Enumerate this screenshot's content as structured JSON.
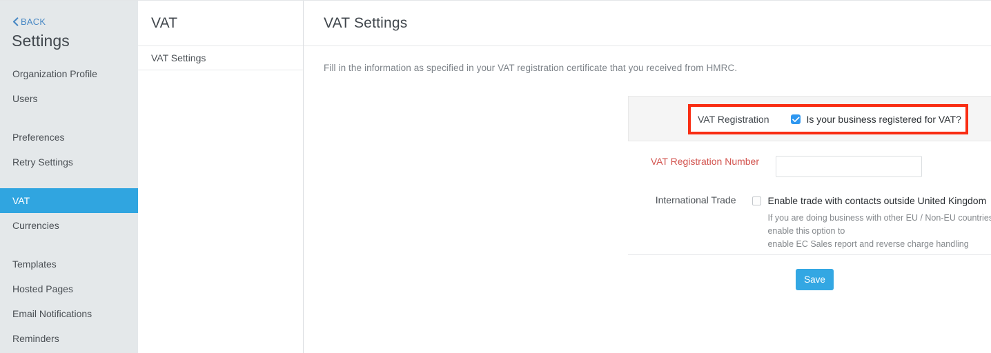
{
  "sidebar": {
    "back_label": "BACK",
    "back_icon": "chevron-left-icon",
    "title": "Settings",
    "groups": [
      {
        "items": [
          {
            "label": "Organization Profile",
            "active": false
          },
          {
            "label": "Users",
            "active": false
          }
        ]
      },
      {
        "items": [
          {
            "label": "Preferences",
            "active": false
          },
          {
            "label": "Retry Settings",
            "active": false
          }
        ]
      },
      {
        "items": [
          {
            "label": "VAT",
            "active": true
          },
          {
            "label": "Currencies",
            "active": false
          }
        ]
      },
      {
        "items": [
          {
            "label": "Templates",
            "active": false
          },
          {
            "label": "Hosted Pages",
            "active": false
          },
          {
            "label": "Email Notifications",
            "active": false
          },
          {
            "label": "Reminders",
            "active": false
          }
        ]
      }
    ]
  },
  "midcol": {
    "title": "VAT",
    "items": [
      {
        "label": "VAT Settings"
      }
    ]
  },
  "main": {
    "title": "VAT Settings",
    "description": "Fill in the information as specified in your VAT registration certificate that you received from HMRC.",
    "vat_registration": {
      "label": "VAT Registration",
      "checkbox_icon": "checkmark-icon",
      "checkbox_checked": true,
      "question": "Is your business registered for VAT?"
    },
    "vat_registration_number": {
      "label": "VAT Registration Number",
      "value": "",
      "placeholder": ""
    },
    "international_trade": {
      "label": "International Trade",
      "checkbox_checked": false,
      "option_label": "Enable trade with contacts outside United Kingdom",
      "help_line_1": "If you are doing business with other EU / Non-EU countries, enable this option to",
      "help_line_2": "enable EC Sales report and reverse charge handling"
    },
    "save_label": "Save"
  },
  "colors": {
    "accent_blue": "#33a7e3",
    "sidebar_bg": "#e4e8ea",
    "required_red": "#d2524d",
    "highlight_red": "#f92d13",
    "checkbox_blue": "#2e97f0"
  }
}
